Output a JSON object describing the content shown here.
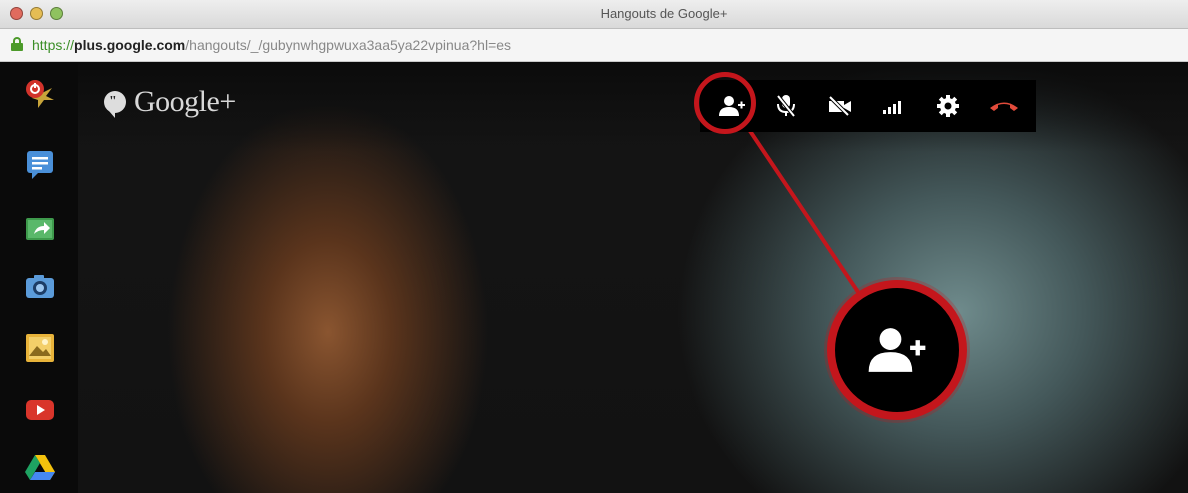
{
  "window": {
    "title": "Hangouts de Google+"
  },
  "address_bar": {
    "protocol": "https://",
    "host": "plus.google.com",
    "path": "/hangouts/_/gubynwhgpwuxa3aa5ya22vpinua?hl=es"
  },
  "app": {
    "logo_text": "Google+"
  },
  "sidebar": {
    "items": [
      {
        "name": "hangouts-icon"
      },
      {
        "name": "chat-icon"
      },
      {
        "name": "screenshare-icon"
      },
      {
        "name": "camera-icon"
      },
      {
        "name": "photos-icon"
      },
      {
        "name": "youtube-icon"
      },
      {
        "name": "drive-icon"
      }
    ]
  },
  "toolbar": {
    "buttons": [
      {
        "name": "invite-people-icon"
      },
      {
        "name": "mute-mic-icon"
      },
      {
        "name": "camera-off-icon"
      },
      {
        "name": "signal-icon"
      },
      {
        "name": "settings-gear-icon"
      },
      {
        "name": "hang-up-icon"
      }
    ]
  },
  "colors": {
    "highlight_red": "#c4161c",
    "hangup_red": "#e24b3b",
    "secure_green": "#3a8e26"
  }
}
